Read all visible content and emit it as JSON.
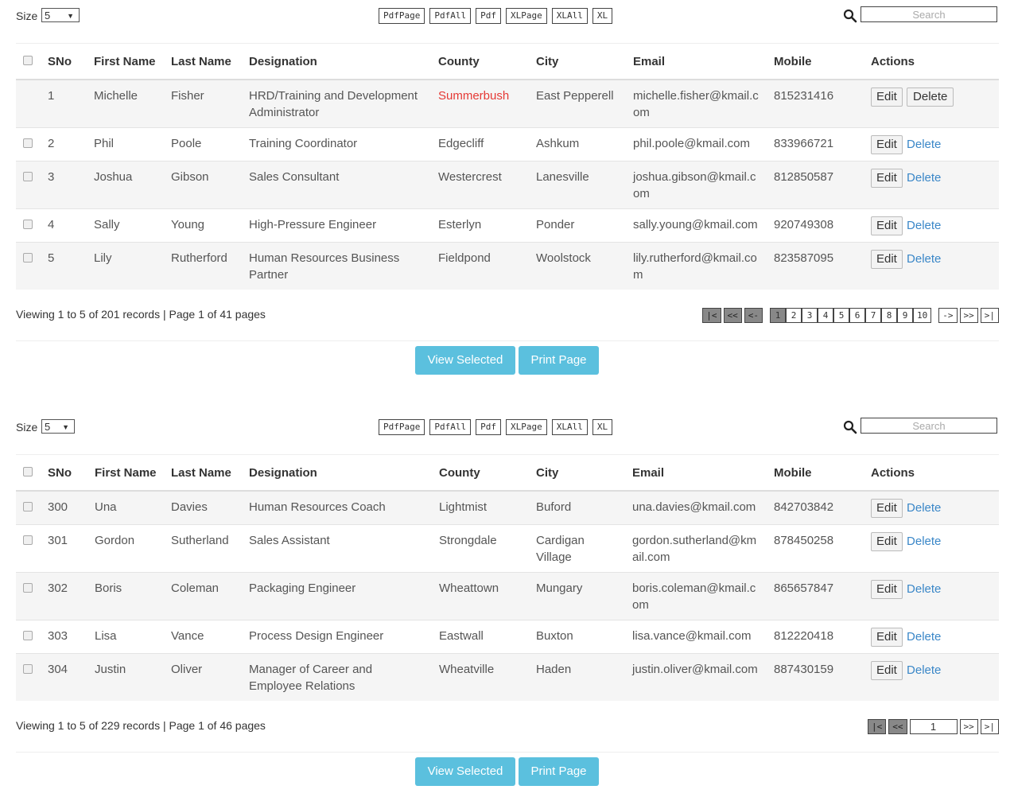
{
  "grids": [
    {
      "size_label": "Size",
      "size_value": "5",
      "exports": [
        "PdfPage",
        "PdfAll",
        "Pdf",
        "XLPage",
        "XLAll",
        "XL"
      ],
      "search_placeholder": "Search",
      "columns": [
        "SNo",
        "First Name",
        "Last Name",
        "Designation",
        "County",
        "City",
        "Email",
        "Mobile",
        "Actions"
      ],
      "rows": [
        {
          "sno": "1",
          "first": "Michelle",
          "last": "Fisher",
          "designation": "HRD/Training and Development Administrator",
          "county": "Summerbush",
          "city": "East Pepperell",
          "email": "michelle.fisher@kmail.com",
          "mobile": "815231416",
          "edit": "Edit",
          "delete": "Delete"
        },
        {
          "sno": "2",
          "first": "Phil",
          "last": "Poole",
          "designation": "Training Coordinator",
          "county": "Edgecliff",
          "city": "Ashkum",
          "email": "phil.poole@kmail.com",
          "mobile": "833966721",
          "edit": "Edit",
          "delete": "Delete"
        },
        {
          "sno": "3",
          "first": "Joshua",
          "last": "Gibson",
          "designation": "Sales Consultant",
          "county": "Westercrest",
          "city": "Lanesville",
          "email": "joshua.gibson@kmail.com",
          "mobile": "812850587",
          "edit": "Edit",
          "delete": "Delete"
        },
        {
          "sno": "4",
          "first": "Sally",
          "last": "Young",
          "designation": "High-Pressure Engineer",
          "county": "Esterlyn",
          "city": "Ponder",
          "email": "sally.young@kmail.com",
          "mobile": "920749308",
          "edit": "Edit",
          "delete": "Delete"
        },
        {
          "sno": "5",
          "first": "Lily",
          "last": "Rutherford",
          "designation": "Human Resources Business Partner",
          "county": "Fieldpond",
          "city": "Woolstock",
          "email": "lily.rutherford@kmail.com",
          "mobile": "823587095",
          "edit": "Edit",
          "delete": "Delete"
        }
      ],
      "viewing_text": "Viewing 1 to 5 of 201 records | Page 1 of 41 pages",
      "pager_nav_start": [
        "|<",
        "<<",
        "<-"
      ],
      "pager_pages": [
        "1",
        "2",
        "3",
        "4",
        "5",
        "6",
        "7",
        "8",
        "9",
        "10"
      ],
      "pager_nav_end": [
        "->",
        ">>",
        ">|"
      ],
      "view_selected": "View Selected",
      "print_page": "Print Page"
    },
    {
      "size_label": "Size",
      "size_value": "5",
      "exports": [
        "PdfPage",
        "PdfAll",
        "Pdf",
        "XLPage",
        "XLAll",
        "XL"
      ],
      "search_placeholder": "Search",
      "columns": [
        "SNo",
        "First Name",
        "Last Name",
        "Designation",
        "County",
        "City",
        "Email",
        "Mobile",
        "Actions"
      ],
      "rows": [
        {
          "sno": "300",
          "first": "Una",
          "last": "Davies",
          "designation": "Human Resources Coach",
          "county": "Lightmist",
          "city": "Buford",
          "email": "una.davies@kmail.com",
          "mobile": "842703842",
          "edit": "Edit",
          "delete": "Delete"
        },
        {
          "sno": "301",
          "first": "Gordon",
          "last": "Sutherland",
          "designation": "Sales Assistant",
          "county": "Strongdale",
          "city": "Cardigan Village",
          "email": "gordon.sutherland@kmail.com",
          "mobile": "878450258",
          "edit": "Edit",
          "delete": "Delete"
        },
        {
          "sno": "302",
          "first": "Boris",
          "last": "Coleman",
          "designation": "Packaging Engineer",
          "county": "Wheattown",
          "city": "Mungary",
          "email": "boris.coleman@kmail.com",
          "mobile": "865657847",
          "edit": "Edit",
          "delete": "Delete"
        },
        {
          "sno": "303",
          "first": "Lisa",
          "last": "Vance",
          "designation": "Process Design Engineer",
          "county": "Eastwall",
          "city": "Buxton",
          "email": "lisa.vance@kmail.com",
          "mobile": "812220418",
          "edit": "Edit",
          "delete": "Delete"
        },
        {
          "sno": "304",
          "first": "Justin",
          "last": "Oliver",
          "designation": "Manager of Career and Employee Relations",
          "county": "Wheatville",
          "city": "Haden",
          "email": "justin.oliver@kmail.com",
          "mobile": "887430159",
          "edit": "Edit",
          "delete": "Delete"
        }
      ],
      "viewing_text": "Viewing 1 to 5 of 229 records | Page 1 of 46 pages",
      "pager_nav_start": [
        "|<",
        "<<"
      ],
      "page_input_value": "1",
      "pager_nav_end": [
        ">>",
        ">|"
      ],
      "view_selected": "View Selected",
      "print_page": "Print Page"
    }
  ],
  "colors": {
    "highlight_county": "#e53935",
    "link": "#3a87c8",
    "button_blue": "#5bc0de"
  }
}
